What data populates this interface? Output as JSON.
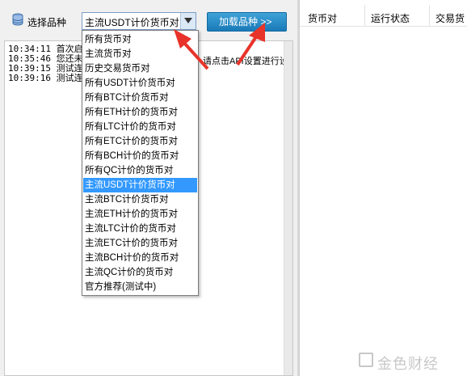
{
  "toolbar": {
    "select_label": "选择品种",
    "combo_value": "主流USDT计价货币对",
    "load_button": "加载品种 >>"
  },
  "log": {
    "lines": [
      {
        "time": "10:34:11",
        "text": "首次启"
      },
      {
        "time": "10:35:46",
        "text": "您还未"
      },
      {
        "time": "10:39:15",
        "text": "测试连"
      },
      {
        "time": "10:39:16",
        "text": "测试连"
      }
    ],
    "trail": "请点击API设置进行设"
  },
  "table": {
    "columns": [
      "货币对",
      "运行状态",
      "交易货"
    ]
  },
  "dropdown": {
    "options": [
      "所有货币对",
      "主流货币对",
      "历史交易货币对",
      "所有USDT计价货币对",
      "所有BTC计价货币对",
      "所有ETH计价的货币对",
      "所有LTC计价的货币对",
      "所有ETC计价的货币对",
      "所有BCH计价的货币对",
      "所有QC计价的货币对",
      "主流USDT计价货币对",
      "主流BTC计价货币对",
      "主流ETH计价的货币对",
      "主流LTC计价的货币对",
      "主流ETC计价的货币对",
      "主流BCH计价的货币对",
      "主流QC计价的货币对",
      "官方推荐(测试中)"
    ],
    "selected_index": 10
  },
  "watermark": "金色财经",
  "colors": {
    "selection": "#3399ff",
    "button": "#2a8cc8",
    "annotation_arrow": "#e8332a"
  }
}
